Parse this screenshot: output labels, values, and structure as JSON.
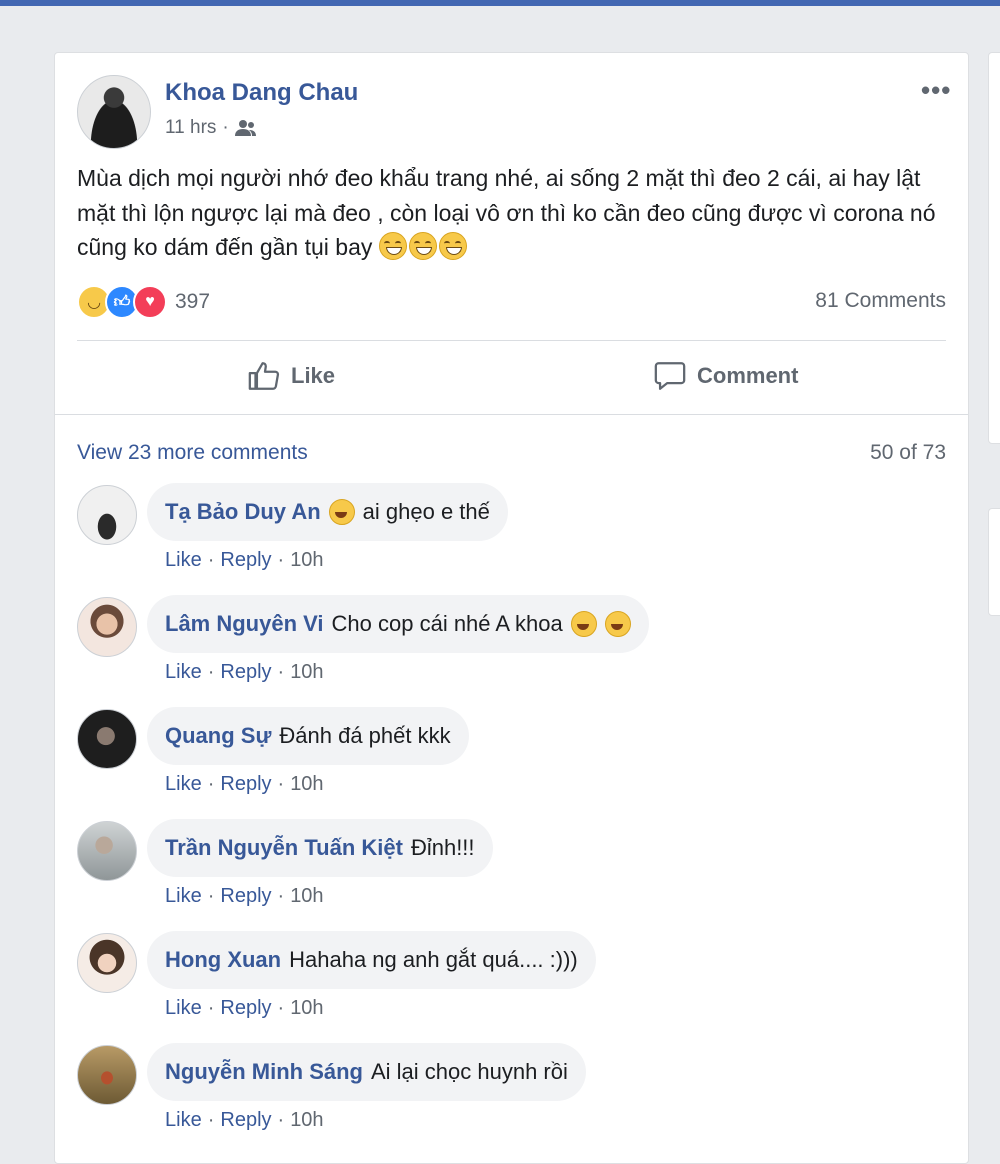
{
  "post": {
    "author": "Khoa Dang Chau",
    "time": "11 hrs",
    "time_sep": "·",
    "text": "Mùa dịch mọi người nhớ đeo khẩu trang nhé, ai sống 2 mặt thì đeo 2 cái, ai hay lật mặt thì lộn ngược lại mà đeo , còn loại vô ơn thì ko cần đeo cũng được vì corona nó cũng ko dám đến gần tụi bay",
    "reaction_count": "397",
    "comments_count": "81 Comments",
    "like_label": "Like",
    "comment_label": "Comment"
  },
  "comments_section": {
    "view_more": "View 23 more comments",
    "pager": "50 of 73"
  },
  "comments": [
    {
      "name": "Tạ Bảo Duy An",
      "text": "ai ghẹo e thế",
      "like": "Like",
      "reply": "Reply",
      "time": "10h",
      "sep": "·"
    },
    {
      "name": "Lâm Nguyên Vi",
      "text": "Cho cop cái nhé A khoa",
      "like": "Like",
      "reply": "Reply",
      "time": "10h",
      "sep": "·"
    },
    {
      "name": "Quang Sự",
      "text": "Đánh đá phết kkk",
      "like": "Like",
      "reply": "Reply",
      "time": "10h",
      "sep": "·"
    },
    {
      "name": "Trần Nguyễn Tuấn Kiệt",
      "text": "Đỉnh!!!",
      "like": "Like",
      "reply": "Reply",
      "time": "10h",
      "sep": "·"
    },
    {
      "name": "Hong Xuan",
      "text": "Hahaha ng anh gắt quá.... :)))",
      "like": "Like",
      "reply": "Reply",
      "time": "10h",
      "sep": "·"
    },
    {
      "name": "Nguyễn Minh Sáng",
      "text": "Ai lại chọc huynh rồi",
      "like": "Like",
      "reply": "Reply",
      "time": "10h",
      "sep": "·"
    }
  ],
  "colors": {
    "link": "#385898",
    "bubble": "#f2f3f5",
    "like": "#2d88ff",
    "love": "#f33e58",
    "haha": "#f7c94a"
  }
}
